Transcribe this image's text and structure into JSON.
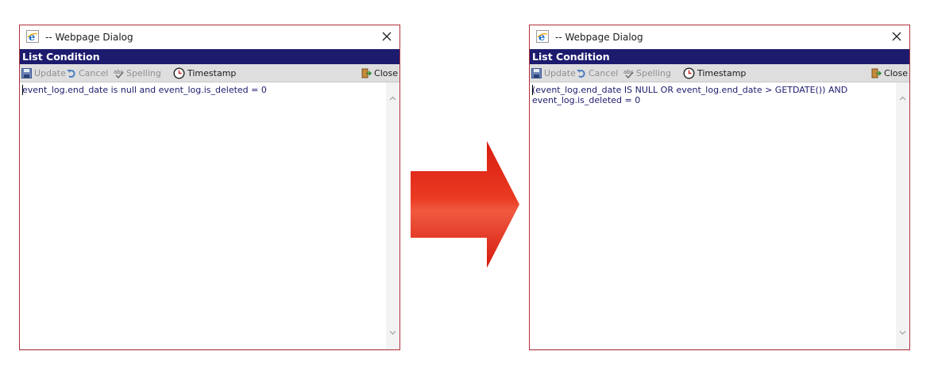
{
  "dialogs": [
    {
      "window_title": "-- Webpage Dialog",
      "header": "List Condition",
      "toolbar": {
        "update": "Update",
        "cancel": "Cancel",
        "spelling": "Spelling",
        "timestamp": "Timestamp",
        "close": "Close"
      },
      "condition_text": "event_log.end_date is null and event_log.is_deleted = 0"
    },
    {
      "window_title": "-- Webpage Dialog",
      "header": "List Condition",
      "toolbar": {
        "update": "Update",
        "cancel": "Cancel",
        "spelling": "Spelling",
        "timestamp": "Timestamp",
        "close": "Close"
      },
      "condition_text": "(event_log.end_date IS NULL OR event_log.end_date > GETDATE()) AND event_log.is_deleted = 0"
    }
  ],
  "colors": {
    "header_bg": "#1c1b6e",
    "dialog_border": "#b3303a",
    "arrow_red": "#e02010",
    "text_navy": "#1c1b6e"
  },
  "icons": {
    "window": "internet-explorer-icon",
    "update": "floppy-disk-icon",
    "cancel": "undo-icon",
    "spelling": "spellcheck-icon",
    "timestamp": "clock-icon",
    "close": "exit-door-icon",
    "transition": "right-arrow-icon"
  }
}
